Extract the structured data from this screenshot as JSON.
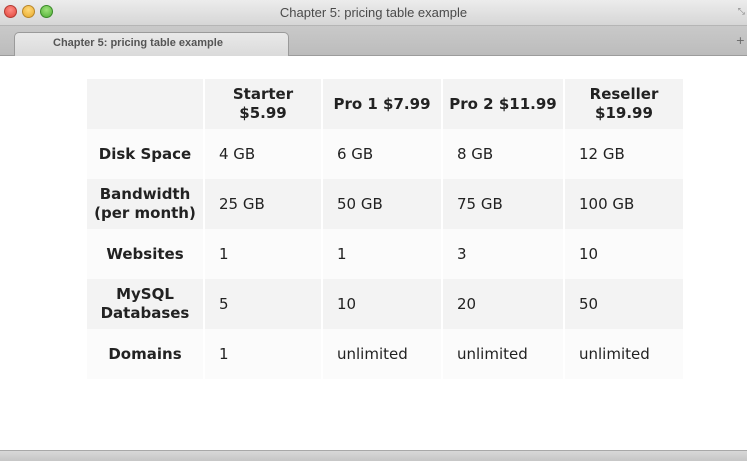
{
  "window": {
    "title": "Chapter 5: pricing table example",
    "tab_label": "Chapter 5: pricing table example",
    "new_tab_symbol": "+",
    "resize_symbol": "⤡"
  },
  "pricing_table": {
    "plans": [
      "Starter $5.99",
      "Pro 1 $7.99",
      "Pro 2 $11.99",
      "Reseller $19.99"
    ],
    "rows": [
      {
        "feature": "Disk Space",
        "values": [
          "4 GB",
          "6 GB",
          "8 GB",
          "12 GB"
        ]
      },
      {
        "feature": "Bandwidth (per month)",
        "values": [
          "25 GB",
          "50 GB",
          "75 GB",
          "100 GB"
        ]
      },
      {
        "feature": "Websites",
        "values": [
          "1",
          "1",
          "3",
          "10"
        ]
      },
      {
        "feature": "MySQL Databases",
        "values": [
          "5",
          "10",
          "20",
          "50"
        ]
      },
      {
        "feature": "Domains",
        "values": [
          "1",
          "unlimited",
          "unlimited",
          "unlimited"
        ]
      }
    ]
  },
  "colors": {
    "close": "#e0443a",
    "minimize": "#e8a92a",
    "maximize": "#4fae36",
    "table_header_bg": "#f3f3f3",
    "table_row_light": "#fbfbfb"
  }
}
